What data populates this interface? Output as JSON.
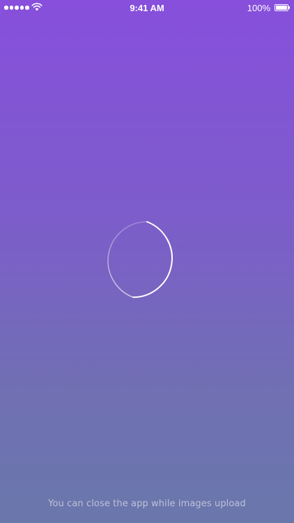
{
  "status_bar": {
    "time": "9:41 AM",
    "battery_percent": "100%",
    "signal_bars": 5,
    "wifi_icon": "wifi-icon",
    "battery_icon": "battery-icon"
  },
  "loader": {
    "icon": "circular-progress-spinner",
    "color": "#ffffff"
  },
  "footer": {
    "message": "You can close the app while images upload"
  },
  "colors": {
    "background_top": "#874fdc",
    "background_bottom": "#6a77ab"
  }
}
